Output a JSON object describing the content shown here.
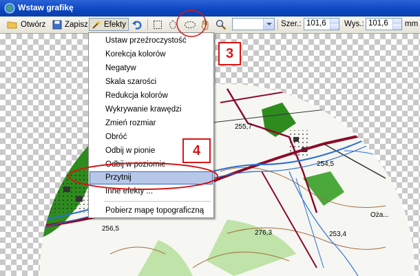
{
  "window": {
    "title": "Wstaw grafikę"
  },
  "toolbar": {
    "open_label": "Otwórz",
    "save_label": "Zapisz",
    "effects_label": "Efekty",
    "width_label": "Szer.:",
    "width_value": "101,6",
    "height_label": "Wys.:",
    "height_value": "101,6",
    "unit_label": "mm",
    "zoom_value": ""
  },
  "menu": {
    "items": [
      "Ustaw przeźroczystość",
      "Korekcja kolorów",
      "Negatyw",
      "Skala szarości",
      "Redukcja kolorów",
      "Wykrywanie krawędzi",
      "Zmień rozmiar",
      "Obróć",
      "Odbij w pionie",
      "Odbij w poziomie",
      "Przytnij",
      "Inne efekty ...",
      "Pobierz mapę topograficzną"
    ],
    "selected": "Przytnij"
  },
  "callouts": {
    "step3": "3",
    "step4": "4"
  },
  "map_labels": [
    "255,7",
    "254,5",
    "256,5",
    "276,3",
    "253,4",
    "Oża..."
  ],
  "colors": {
    "titlebar": "#0b45c0",
    "highlight": "#b6c7e8",
    "annotation": "#d61515",
    "map_green": "#2e8b1e",
    "map_road": "#8b0a2a",
    "map_river": "#2a6fd6"
  },
  "icons": [
    "globe-icon",
    "folder-icon",
    "save-icon",
    "magic-wand-icon",
    "undo-icon",
    "rect-select-icon",
    "lasso-icon",
    "ellipse-select-icon",
    "pan-hand-icon",
    "zoom-icon"
  ]
}
